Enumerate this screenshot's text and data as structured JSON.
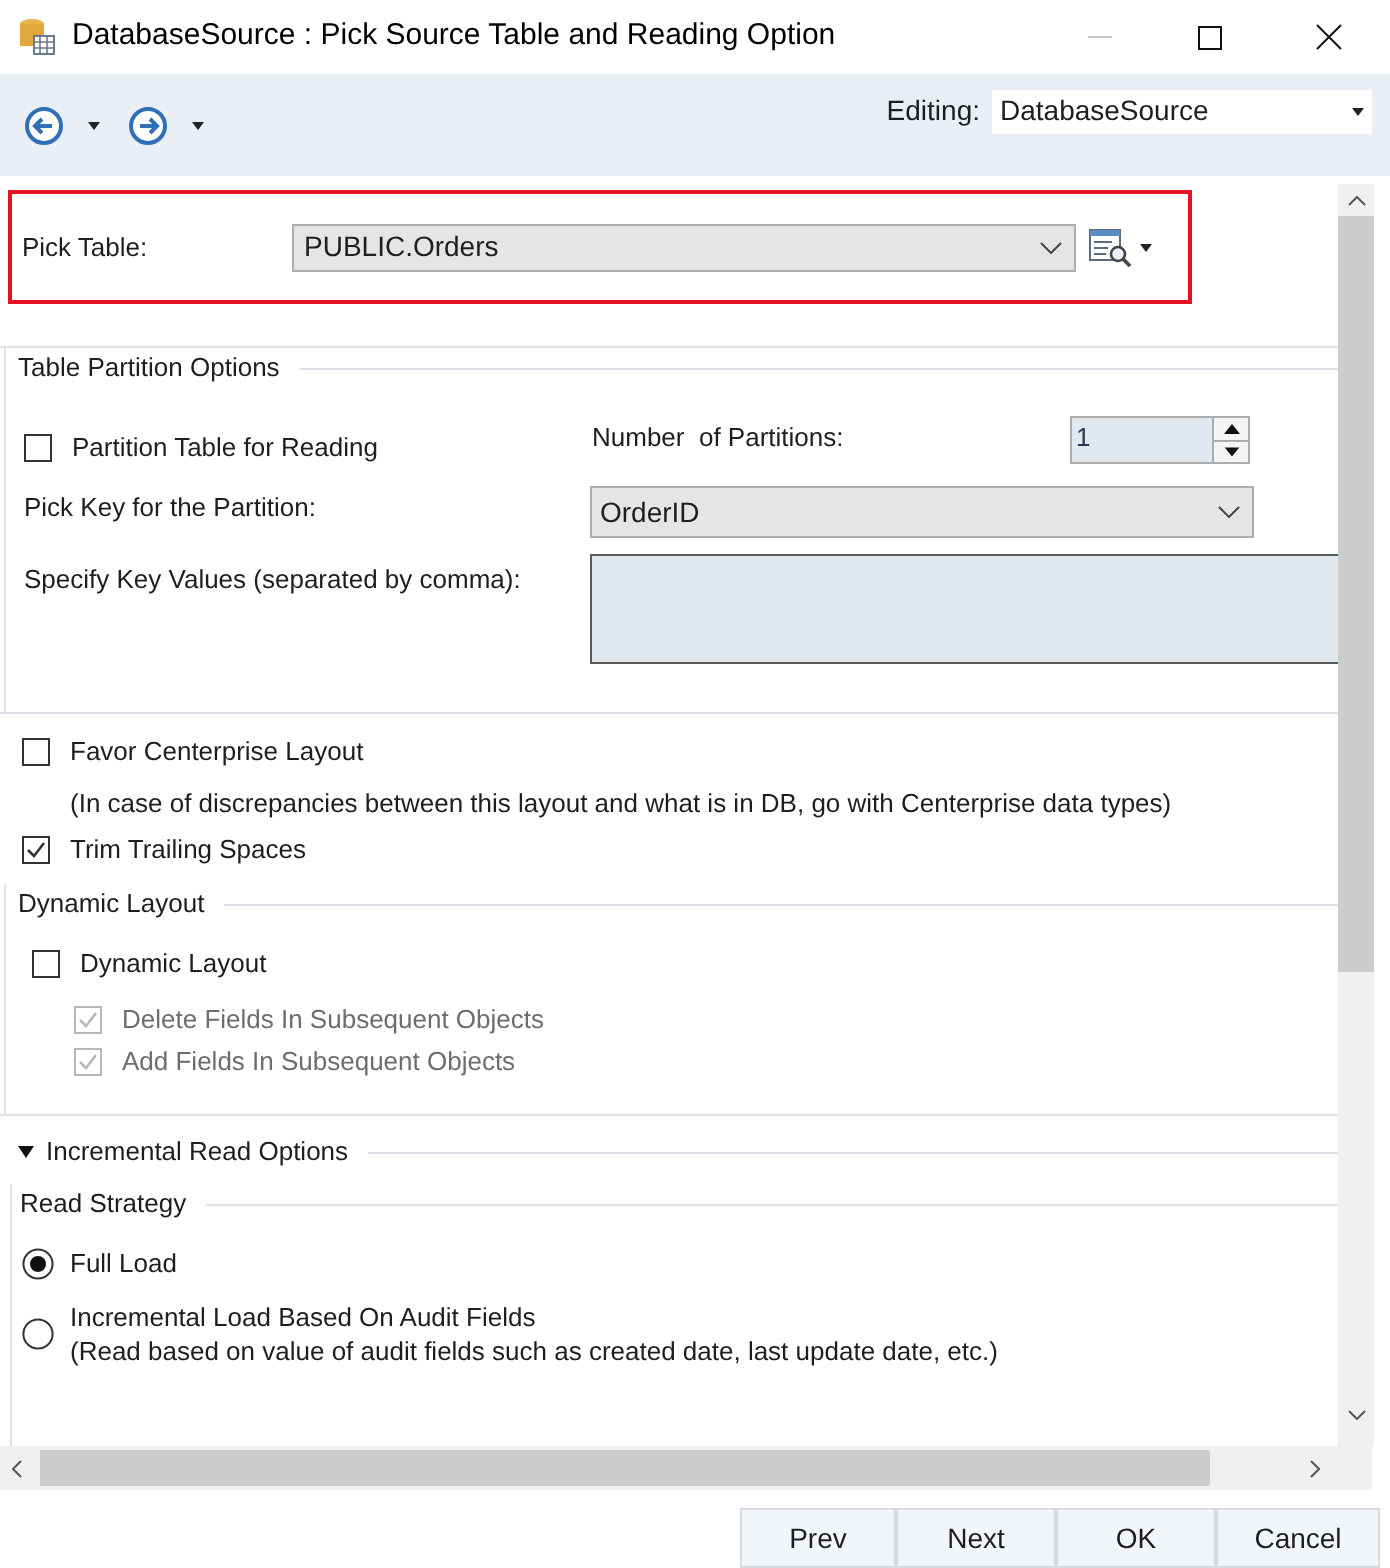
{
  "window": {
    "title": "DatabaseSource : Pick Source Table and Reading Option"
  },
  "toolbar": {
    "editing_label": "Editing:",
    "editing_value": "DatabaseSource"
  },
  "pick_table": {
    "label": "Pick Table:",
    "value": "PUBLIC.Orders"
  },
  "partition": {
    "title": "Table Partition Options",
    "checkbox": {
      "label": "Partition Table for Reading",
      "checked": false
    },
    "count_label": "Number  of Partitions:",
    "count_value": "1",
    "key_label": "Pick Key for the Partition:",
    "key_value": "OrderID",
    "values_label": "Specify Key Values (separated by comma):"
  },
  "options": [
    {
      "label": "Favor Centerprise Layout",
      "checked": false,
      "note": "(In case of discrepancies between this layout and what is in DB, go with Centerprise data types)"
    },
    {
      "label": "Trim Trailing Spaces",
      "checked": true
    }
  ],
  "dynamic_layout": {
    "title": "Dynamic Layout",
    "checkbox": {
      "label": "Dynamic Layout",
      "checked": false
    },
    "sub_options": [
      {
        "label": "Delete Fields In Subsequent Objects",
        "checked": true,
        "disabled": true
      },
      {
        "label": "Add Fields In Subsequent Objects",
        "checked": true,
        "disabled": true
      }
    ]
  },
  "incremental": {
    "title": "Incremental Read Options",
    "expanded": true,
    "strategy_title": "Read Strategy",
    "strategies": [
      {
        "label": "Full Load",
        "selected": true
      },
      {
        "label": "Incremental Load Based On Audit Fields",
        "note": "(Read based on value of audit fields such as created date, last update date, etc.)",
        "selected": false
      }
    ]
  },
  "buttons": [
    "Prev",
    "Next",
    "OK",
    "Cancel"
  ]
}
